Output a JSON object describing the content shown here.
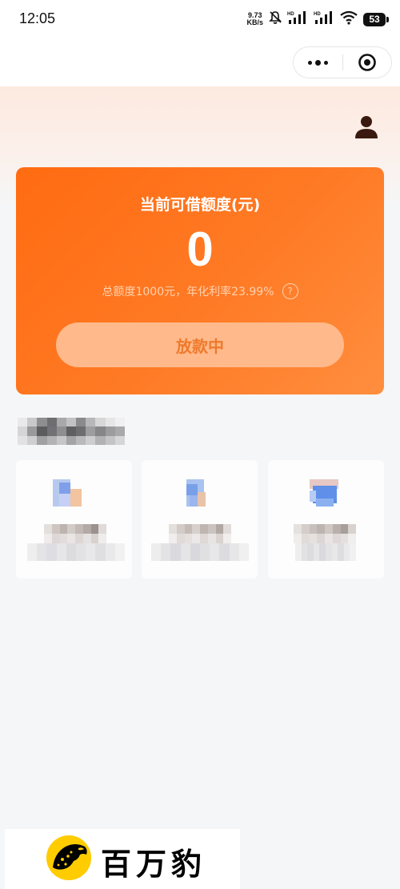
{
  "status_bar": {
    "time": "12:05",
    "net_speed_value": "9.73",
    "net_speed_unit": "KB/s",
    "battery": "53",
    "icons": [
      "mute-icon",
      "signal-hd-1-icon",
      "signal-hd-2-icon",
      "wifi-icon",
      "battery-icon"
    ]
  },
  "nav": {
    "icons": [
      "more-dots-icon",
      "close-target-icon"
    ]
  },
  "header": {
    "icons": [
      "user-profile-icon"
    ]
  },
  "credit_card": {
    "title": "当前可借额度(元)",
    "amount": "0",
    "info": "总额度1000元，年化利率23.99%",
    "help_symbol": "?",
    "button_label": "放款中"
  },
  "brand": {
    "name": "百万豹",
    "logo_icon": "leopard-logo-icon"
  },
  "colors": {
    "accent": "#ff6b11",
    "accent_light": "#ff8e3f",
    "button_bg": "#ffb98a",
    "button_text": "#ef7a2c",
    "info_text": "#ffd2b0",
    "logo_yellow": "#ffcc00"
  }
}
